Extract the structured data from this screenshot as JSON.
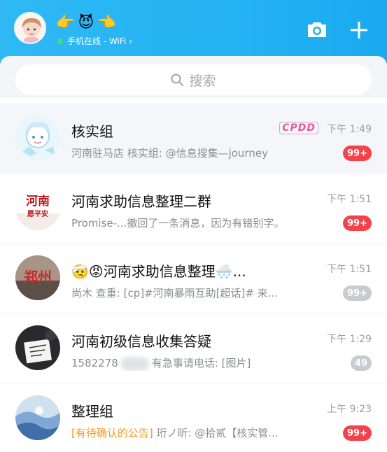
{
  "header": {
    "emojis": [
      "👉",
      "😈",
      "👈"
    ],
    "status_text": "手机在线 - WiFi",
    "status_chevron": "›",
    "icons": {
      "camera": "camera-icon",
      "plus": "plus-icon"
    },
    "bg_color": "#24b3f3"
  },
  "search": {
    "label": "搜索"
  },
  "chats": [
    {
      "title": "核实组",
      "preview": "河南驻马店 核实组: @信息搜集—journey",
      "time": "下午 1:49",
      "tag": "CPDD",
      "badge": "99+",
      "badge_color": "red",
      "pinned": true
    },
    {
      "title": "河南求助信息整理二群",
      "preview": "Promise-...撤回了一条消息，因为有错别字。",
      "time": "下午 1:51",
      "badge": "99+",
      "badge_color": "red",
      "avatar_text_top": "河南",
      "avatar_text_bottom": "愿平安"
    },
    {
      "title_prefix": "🤕😡",
      "title": "河南求助信息整理🌨️...",
      "preview": "尚木 查重: [cp]#河南暴雨互助[超话]# 来...",
      "time": "下午 1:51",
      "badge": "99+",
      "badge_color": "gray",
      "avatar_text": "郑州"
    },
    {
      "title": "河南初级信息收集答疑",
      "preview_start": "1582278",
      "preview_end": "有急事请电话: [图片]",
      "time": "下午 1:29",
      "badge": "49",
      "badge_color": "gray"
    },
    {
      "title": "整理组",
      "preview_notice": "[有待确认的公告]",
      "preview": " 珩ノ昕: @拾贰【核实管...",
      "time": "上午 9:23",
      "badge": "99+",
      "badge_color": "red"
    }
  ]
}
